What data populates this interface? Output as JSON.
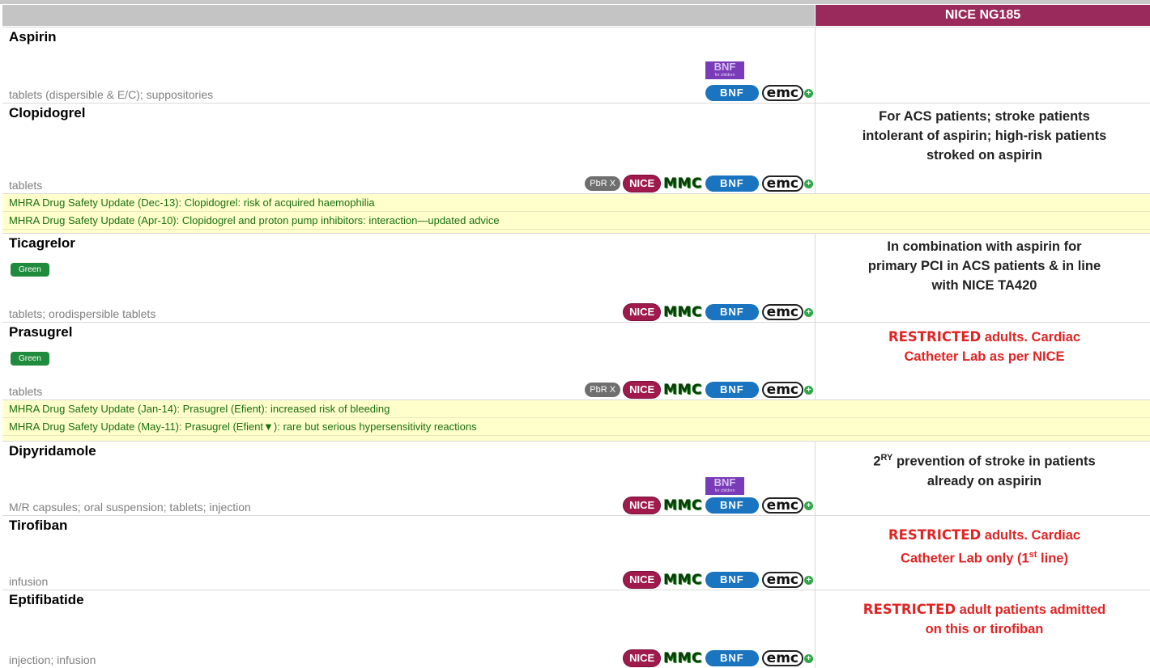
{
  "header": {
    "guideline": "NICE NG185"
  },
  "drugs": [
    {
      "name": "Aspirin",
      "forms": "tablets (dispersible & E/C); suppositories",
      "note": ""
    },
    {
      "name": "Clopidogrel",
      "forms": "tablets",
      "note_lines": [
        "For ACS patients; stroke patients",
        "intolerant of aspirin; high-risk patients",
        "stroked on aspirin"
      ]
    },
    {
      "name": "Ticagrelor",
      "tag": "Green",
      "forms": "tablets; orodispersible tablets",
      "note_lines": [
        "In combination with aspirin for",
        "primary PCI in ACS patients & in line",
        "with NICE TA420"
      ]
    },
    {
      "name": "Prasugrel",
      "tag": "Green",
      "forms": "tablets",
      "restricted": "RESTRICTED",
      "note_lines": [
        "adults. Cardiac",
        "Catheter Lab as per NICE"
      ]
    },
    {
      "name": "Dipyridamole",
      "forms": "M/R capsules; oral suspension; tablets; injection",
      "note_prefix": "2",
      "note_sup": "RY",
      "note_lines": [
        "prevention of stroke in patients",
        "already on aspirin"
      ]
    },
    {
      "name": "Tirofiban",
      "forms": "infusion",
      "restricted": "RESTRICTED",
      "note_lines": [
        "adults. Cardiac",
        "Catheter Lab only (1",
        "st",
        "line)"
      ]
    },
    {
      "name": "Eptifibatide",
      "forms": "injection; infusion",
      "restricted": "RESTRICTED",
      "note_lines": [
        "adult patients admitted",
        "on this or tirofiban"
      ]
    }
  ],
  "mhra": {
    "clopidogrel": [
      "MHRA Drug Safety Update (Dec-13): Clopidogrel: risk of acquired haemophilia",
      "MHRA Drug Safety Update (Apr-10): Clopidogrel and proton pump inhibitors: interaction—updated advice"
    ],
    "prasugrel": [
      "MHRA Drug Safety Update (Jan-14): Prasugrel (Efient): increased risk of bleeding",
      "MHRA Drug Safety Update (May-11): Prasugrel (Efient▼): rare but serious hypersensitivity reactions"
    ]
  },
  "badges": {
    "pbr": "PbR X",
    "nice": "NICE",
    "mmc": "MMC",
    "bnf": "BNF",
    "emc": "emc",
    "emc_plus": "+",
    "bnfc": "BNF",
    "bnfc_sub": "for children"
  },
  "colors": {
    "header_accent": "#9b2a5c",
    "restricted": "#e02424",
    "mhra_bg": "#ffffcc",
    "mhra_text": "#1a6e0e",
    "green_tag": "#1f8b3c"
  }
}
